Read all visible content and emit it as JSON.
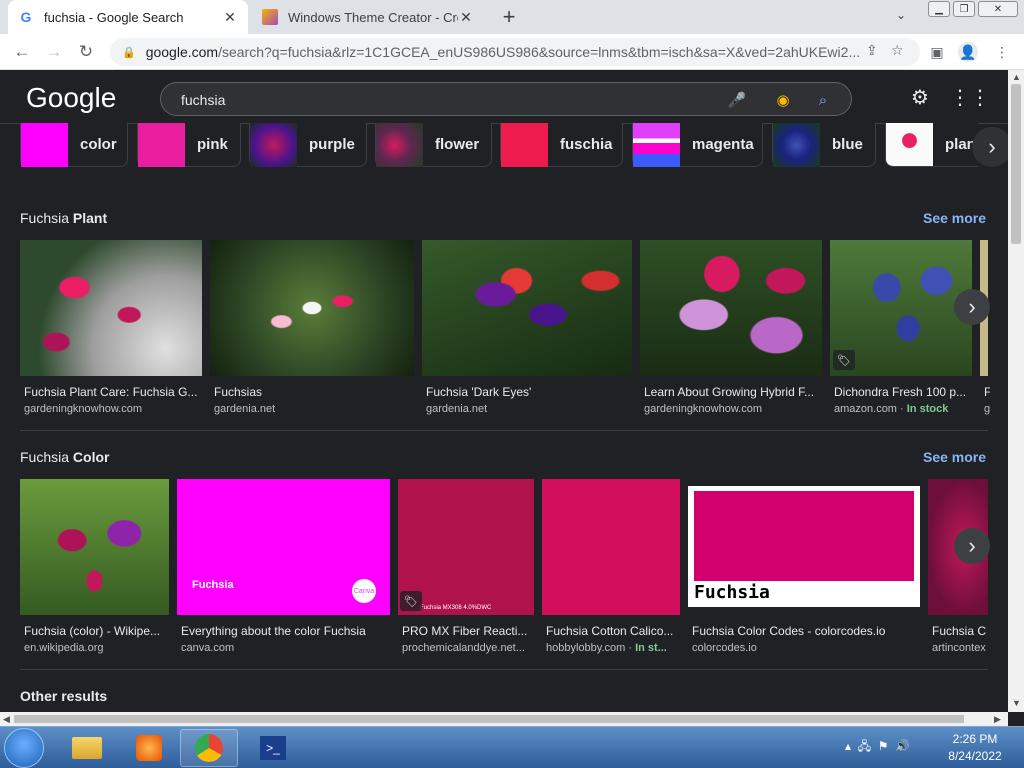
{
  "browser": {
    "tabs": [
      {
        "title": "fuchsia - Google Search",
        "active": true
      },
      {
        "title": "Windows Theme Creator - Create",
        "active": false
      }
    ],
    "url_host": "google.com",
    "url_rest": "/search?q=fuchsia&rlz=1C1GCEA_enUS986US986&source=lnms&tbm=isch&sa=X&ved=2ahUKEwi2..."
  },
  "google": {
    "logo": "Google",
    "query": "fuchsia"
  },
  "chips": [
    {
      "label": "color",
      "color": "#ff00ff"
    },
    {
      "label": "pink",
      "color": "#e91e9e"
    },
    {
      "label": "purple",
      "color": "#6a2c70"
    },
    {
      "label": "flower",
      "color": "#7b2a4a"
    },
    {
      "label": "fuschia",
      "color": "#ee1c4e"
    },
    {
      "label": "magenta",
      "color": "#e040fb"
    },
    {
      "label": "blue",
      "color": "#3b3a9a"
    },
    {
      "label": "plan",
      "color": "#f4f4f4"
    }
  ],
  "sections": [
    {
      "title_prefix": "Fuchsia",
      "title_bold": "Plant",
      "see_more": "See more",
      "items": [
        {
          "title": "Fuchsia Plant Care: Fuchsia G...",
          "source": "gardeningknowhow.com",
          "stock": ""
        },
        {
          "title": "Fuchsias",
          "source": "gardenia.net",
          "stock": ""
        },
        {
          "title": "Fuchsia 'Dark Eyes'",
          "source": "gardenia.net",
          "stock": ""
        },
        {
          "title": "Learn About Growing Hybrid F...",
          "source": "gardeningknowhow.com",
          "stock": ""
        },
        {
          "title": "Dichondra Fresh 100 p...",
          "source": "amazon.com · ",
          "stock": "In stock"
        },
        {
          "title": "F",
          "source": "g",
          "stock": ""
        }
      ]
    },
    {
      "title_prefix": "Fuchsia",
      "title_bold": "Color",
      "see_more": "See more",
      "items": [
        {
          "title": "Fuchsia (color) - Wikipe...",
          "source": "en.wikipedia.org",
          "stock": ""
        },
        {
          "title": "Everything about the color Fuchsia",
          "source": "canva.com",
          "stock": ""
        },
        {
          "title": "PRO MX Fiber Reacti...",
          "source": "prochemicalanddye.net...",
          "stock": ""
        },
        {
          "title": "Fuchsia Cotton Calico...",
          "source": "hobbylobby.com · ",
          "stock": "In st..."
        },
        {
          "title": "Fuchsia Color Codes - colorcodes.io",
          "source": "colorcodes.io",
          "stock": ""
        },
        {
          "title": "Fuchsia C",
          "source": "artincontex",
          "stock": ""
        }
      ]
    }
  ],
  "thumb_text": {
    "canva_title": "Fuchsia",
    "canva_logo": "Canva",
    "mx_label": "Fuchsia MX308  4.0%DWC",
    "colorcodes_label": "Fuchsia"
  },
  "other_results": "Other results",
  "taskbar": {
    "time": "2:26 PM",
    "date": "8/24/2022"
  }
}
